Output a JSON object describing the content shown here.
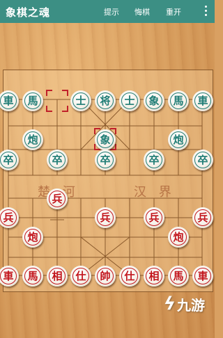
{
  "app": {
    "title": "象棋之魂",
    "actions": {
      "hint": "提示",
      "undo": "悔棋",
      "restart": "重开"
    }
  },
  "river": {
    "left": "楚 河",
    "right": "汉 界"
  },
  "pieces": {
    "teal_back": [
      "車",
      "馬",
      "士",
      "将",
      "士",
      "象",
      "馬",
      "車"
    ],
    "teal_elephant_center": "象",
    "teal_cannons": [
      "炮",
      "炮"
    ],
    "teal_pawns": [
      "卒",
      "卒",
      "卒",
      "卒",
      "卒"
    ],
    "red_advanced_pawn": "兵",
    "red_pawns": [
      "兵",
      "兵",
      "兵",
      "兵"
    ],
    "red_cannons": [
      "炮",
      "炮"
    ],
    "red_back": [
      "車",
      "馬",
      "相",
      "仕",
      "帥",
      "仕",
      "相",
      "馬",
      "車"
    ]
  },
  "watermark": {
    "text": "九游"
  },
  "colors": {
    "appbar": "#3c8f84",
    "red": "#c2141b",
    "teal": "#1f7c74"
  }
}
